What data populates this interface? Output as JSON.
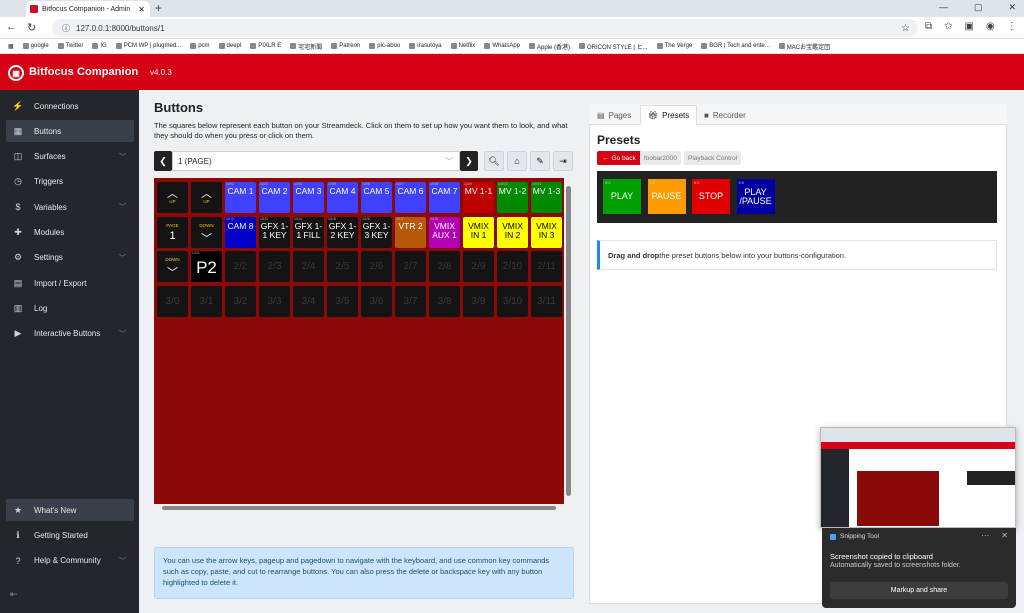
{
  "browser": {
    "tab_title": "Bitfocus Companion - Admin",
    "url": "127.0.0.1:8000/buttons/1",
    "bookmarks": [
      "google",
      "Twitter",
      "IG",
      "PCM WP | plugmed...",
      "pcm",
      "deepl",
      "PIXLR E",
      "宅宅新聞",
      "Patreon",
      "pic-aboo",
      "irasutoya",
      "Netflix",
      "WhatsApp",
      "Apple (香港)",
      "ORICON STYLE | ヒ...",
      "The Verge",
      "BGR | Tech and ente...",
      "MACお宝鑑定団"
    ]
  },
  "app": {
    "title": "Bitfocus Companion",
    "version": "v4.0.3"
  },
  "sidebar": {
    "items": [
      {
        "label": "Connections",
        "icon": "plug-icon",
        "glyph": "⚡",
        "chevron": false
      },
      {
        "label": "Buttons",
        "icon": "grid-icon",
        "glyph": "▦",
        "chevron": false
      },
      {
        "label": "Surfaces",
        "icon": "surfaces-icon",
        "glyph": "◫",
        "chevron": true
      },
      {
        "label": "Triggers",
        "icon": "clock-icon",
        "glyph": "◷",
        "chevron": false
      },
      {
        "label": "Variables",
        "icon": "dollar-icon",
        "glyph": "$",
        "chevron": true
      },
      {
        "label": "Modules",
        "icon": "puzzle-icon",
        "glyph": "✚",
        "chevron": false
      },
      {
        "label": "Settings",
        "icon": "gear-icon",
        "glyph": "⚙",
        "chevron": true
      },
      {
        "label": "Import / Export",
        "icon": "file-icon",
        "glyph": "▤",
        "chevron": false
      },
      {
        "label": "Log",
        "icon": "log-icon",
        "glyph": "▥",
        "chevron": false
      },
      {
        "label": "Interactive Buttons",
        "icon": "play-icon",
        "glyph": "▶",
        "chevron": true
      }
    ],
    "bottom_items": [
      {
        "label": "What's New",
        "icon": "star-icon",
        "glyph": "★",
        "chevron": false
      },
      {
        "label": "Getting Started",
        "icon": "info-icon",
        "glyph": "ℹ",
        "chevron": false
      },
      {
        "label": "Help & Community",
        "icon": "question-icon",
        "glyph": "?",
        "chevron": true
      }
    ]
  },
  "buttons_panel": {
    "title": "Buttons",
    "description": "The squares below represent each button on your Streamdeck. Click on them to set up how you want them to look, and what they should do when you press or click on them.",
    "page_selector": "1 (PAGE)",
    "info": "You can use the arrow keys, pageup and pagedown to navigate with the keyboard, and use common key commands such as copy, paste, and cut to rearrange buttons. You can also press the delete or backspace key with any button highlighted to delete it."
  },
  "grid": {
    "rows": [
      [
        {
          "type": "nav",
          "label": "UP",
          "sym": "︿"
        },
        {
          "type": "nav",
          "label": "UP",
          "sym": "︿"
        },
        {
          "type": "btn",
          "tag": "1/0/2",
          "text": "CAM 1",
          "color": "#4040ff"
        },
        {
          "type": "btn",
          "tag": "1/0/3",
          "text": "CAM 2",
          "color": "#4040ff"
        },
        {
          "type": "btn",
          "tag": "1/0/4",
          "text": "CAM 3",
          "color": "#4040ff"
        },
        {
          "type": "btn",
          "tag": "1/0/5",
          "text": "CAM 4",
          "color": "#4040ff"
        },
        {
          "type": "btn",
          "tag": "1/0/6",
          "text": "CAM 5",
          "color": "#4040ff"
        },
        {
          "type": "btn",
          "tag": "1/0/7",
          "text": "CAM 6",
          "color": "#4040ff"
        },
        {
          "type": "btn",
          "tag": "1/0/8",
          "text": "CAM 7",
          "color": "#4040ff"
        },
        {
          "type": "btn",
          "tag": "1/0/9",
          "text": "MV 1-1",
          "color": "#c00000"
        },
        {
          "type": "btn",
          "tag": "1/0/10",
          "text": "MV 1-2",
          "color": "#008a00"
        },
        {
          "type": "btn",
          "tag": "1/0/11",
          "text": "MV 1-3",
          "color": "#008a00"
        }
      ],
      [
        {
          "type": "nav",
          "label": "PAGE",
          "sym": "1"
        },
        {
          "type": "nav",
          "label": "DOWN",
          "sym": "﹀"
        },
        {
          "type": "btn",
          "tag": "1/1/2",
          "text": "CAM 8",
          "color": "#0000c8"
        },
        {
          "type": "btn",
          "tag": "1/1/3",
          "text": "GFX 1-1 KEY",
          "color": "#141414"
        },
        {
          "type": "btn",
          "tag": "1/1/4",
          "text": "GFX 1-1 FILL",
          "color": "#141414"
        },
        {
          "type": "btn",
          "tag": "1/1/5",
          "text": "GFX 1-2 KEY",
          "color": "#141414"
        },
        {
          "type": "btn",
          "tag": "1/1/6",
          "text": "GFX 1-3 KEY",
          "color": "#141414"
        },
        {
          "type": "btn",
          "tag": "1/1/7",
          "text": "VTR 2",
          "color": "#b45a0a"
        },
        {
          "type": "btn",
          "tag": "1/1/8",
          "text": "VMIX AUX 1",
          "color": "#b400b4"
        },
        {
          "type": "btn",
          "tag": "1/1/9",
          "text": "VMIX IN 1",
          "color": "#ffff00",
          "fg": "#000"
        },
        {
          "type": "btn",
          "tag": "1/1/10",
          "text": "VMIX IN 2",
          "color": "#ffff00",
          "fg": "#000"
        },
        {
          "type": "btn",
          "tag": "1/1/11",
          "text": "VMIX IN 3",
          "color": "#ffff00",
          "fg": "#000"
        }
      ],
      [
        {
          "type": "nav",
          "label": "DOWN",
          "sym": "﹀"
        },
        {
          "type": "big",
          "tag": "1/2/1",
          "text": "P2"
        },
        {
          "type": "empty",
          "text": "2/2"
        },
        {
          "type": "empty",
          "text": "2/3"
        },
        {
          "type": "empty",
          "text": "2/4"
        },
        {
          "type": "empty",
          "text": "2/5"
        },
        {
          "type": "empty",
          "text": "2/6"
        },
        {
          "type": "empty",
          "text": "2/7"
        },
        {
          "type": "empty",
          "text": "2/8"
        },
        {
          "type": "empty",
          "text": "2/9"
        },
        {
          "type": "empty",
          "text": "2/10"
        },
        {
          "type": "empty",
          "text": "2/11"
        }
      ],
      [
        {
          "type": "empty",
          "text": "3/0"
        },
        {
          "type": "empty",
          "text": "3/1"
        },
        {
          "type": "empty",
          "text": "3/2"
        },
        {
          "type": "empty",
          "text": "3/3"
        },
        {
          "type": "empty",
          "text": "3/4"
        },
        {
          "type": "empty",
          "text": "3/5"
        },
        {
          "type": "empty",
          "text": "3/6"
        },
        {
          "type": "empty",
          "text": "3/7"
        },
        {
          "type": "empty",
          "text": "3/8"
        },
        {
          "type": "empty",
          "text": "3/9"
        },
        {
          "type": "empty",
          "text": "3/10"
        },
        {
          "type": "empty",
          "text": "3/11"
        }
      ]
    ]
  },
  "right_panel": {
    "tabs": [
      "Pages",
      "Presets",
      "Recorder"
    ],
    "active_tab": "Presets",
    "title": "Presets",
    "go_back": "Go back",
    "crumbs": [
      "foobar2000",
      "Playback Control"
    ],
    "presets": [
      {
        "tag": "X:X",
        "label": "PLAY",
        "color": "#00a000"
      },
      {
        "tag": "X:X",
        "label": "PAUSE",
        "color": "#ff9a00"
      },
      {
        "tag": "X:X",
        "label": "STOP",
        "color": "#e00000"
      },
      {
        "tag": "X:X",
        "label": "PLAY /PAUSE",
        "color": "#0000a0"
      }
    ],
    "drag_bold": "Drag and drop",
    "drag_rest": " the preset buttons below into your buttons-configuration."
  },
  "toast": {
    "app": "Snipping Tool",
    "line1": "Screenshot copied to clipboard",
    "line2": "Automatically saved to screenshots folder.",
    "action": "Markup and share"
  }
}
